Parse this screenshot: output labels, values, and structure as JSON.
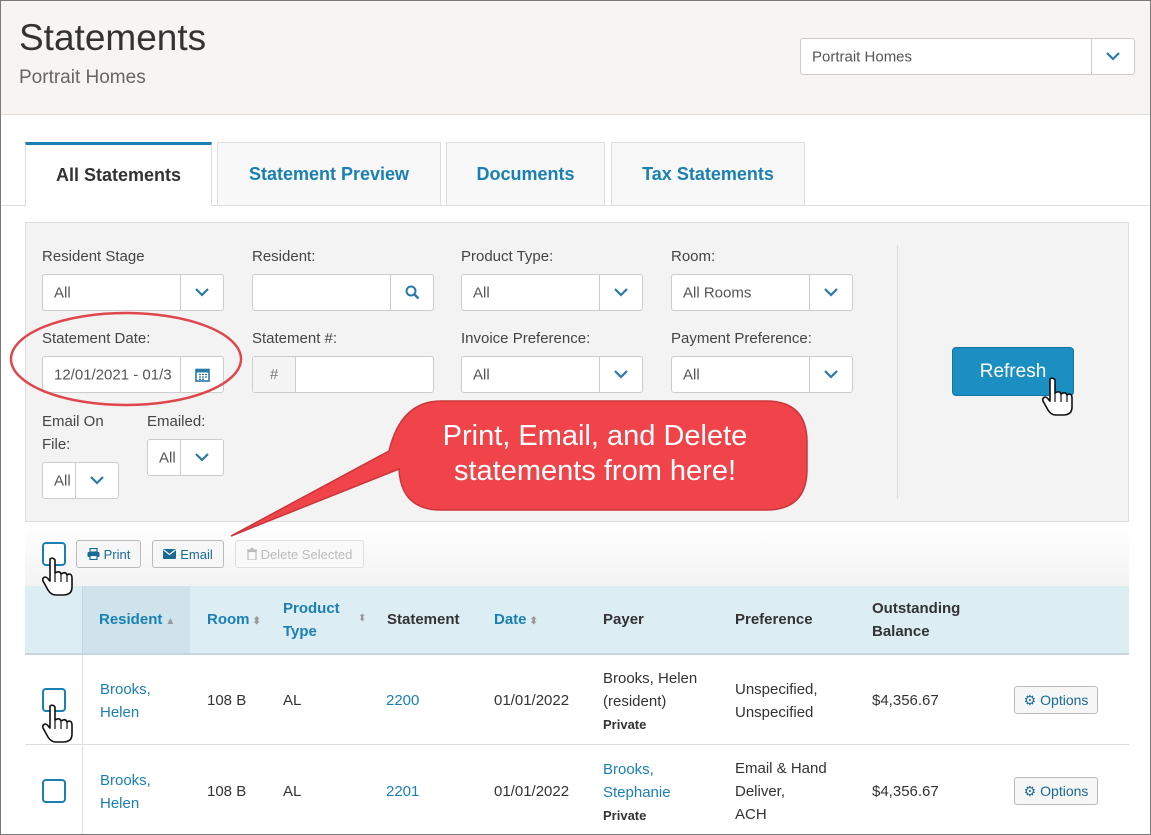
{
  "header": {
    "title": "Statements",
    "subtitle": "Portrait Homes",
    "community_select": "Portrait Homes"
  },
  "tabs": [
    {
      "label": "All Statements",
      "active": true
    },
    {
      "label": "Statement Preview",
      "active": false
    },
    {
      "label": "Documents",
      "active": false
    },
    {
      "label": "Tax Statements",
      "active": false
    }
  ],
  "filters": {
    "resident_stage": {
      "label": "Resident Stage",
      "value": "All"
    },
    "resident": {
      "label": "Resident:",
      "value": ""
    },
    "product_type": {
      "label": "Product Type:",
      "value": "All"
    },
    "room": {
      "label": "Room:",
      "value": "All Rooms"
    },
    "statement_date": {
      "label": "Statement Date:",
      "value": "12/01/2021 - 01/3"
    },
    "statement_num": {
      "label": "Statement #:",
      "prefix": "#",
      "value": ""
    },
    "invoice_pref": {
      "label": "Invoice Preference:",
      "value": "All"
    },
    "payment_pref": {
      "label": "Payment Preference:",
      "value": "All"
    },
    "email_on_file": {
      "label_line1": "Email On",
      "label_line2": "File:",
      "value": "All"
    },
    "emailed": {
      "label": "Emailed:",
      "value": "All"
    },
    "refresh_label": "Refresh"
  },
  "toolbar": {
    "print_label": "Print",
    "email_label": "Email",
    "delete_label": "Delete Selected"
  },
  "table": {
    "headers": {
      "resident": "Resident",
      "room": "Room",
      "product_type_1": "Product",
      "product_type_2": "Type",
      "statement": "Statement",
      "date": "Date",
      "payer": "Payer",
      "preference": "Preference",
      "balance_1": "Outstanding",
      "balance_2": "Balance"
    },
    "rows": [
      {
        "resident_1": "Brooks,",
        "resident_2": "Helen",
        "room": "108 B",
        "product_type": "AL",
        "statement": "2200",
        "date": "01/01/2022",
        "payer_1": "Brooks, Helen",
        "payer_2": "(resident)",
        "payer_type": "Private",
        "pref_1": "Unspecified,",
        "pref_2": "Unspecified",
        "pref_3": "",
        "balance": "$4,356.67",
        "options_label": "Options"
      },
      {
        "resident_1": "Brooks,",
        "resident_2": "Helen",
        "room": "108 B",
        "product_type": "AL",
        "statement": "2201",
        "date": "01/01/2022",
        "payer_1": "Brooks,",
        "payer_2": "Stephanie",
        "payer_type": "Private",
        "pref_1": "Email & Hand",
        "pref_2": "Deliver,",
        "pref_3": "ACH",
        "balance": "$4,356.67",
        "options_label": "Options"
      }
    ]
  },
  "callout": {
    "line1": "Print, Email, and Delete",
    "line2": "statements from here!"
  },
  "colors": {
    "accent": "#1a80b4",
    "callout_red": "#f0444a",
    "refresh_bg": "#1b8fc2",
    "header_row_bg": "#ddedf4"
  }
}
